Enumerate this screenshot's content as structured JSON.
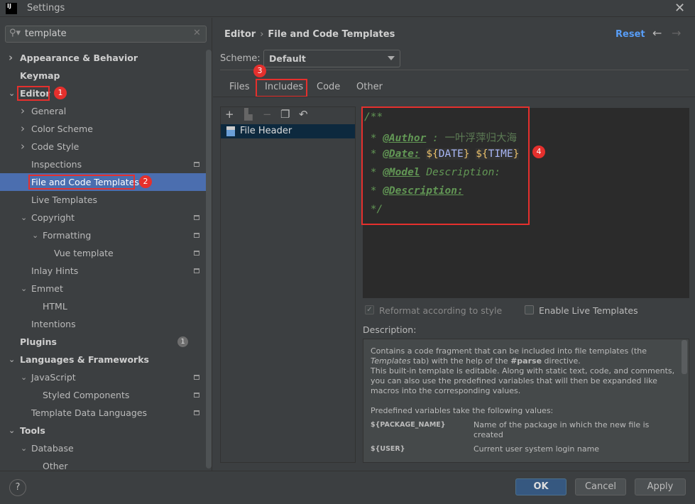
{
  "window": {
    "title": "Settings",
    "app_icon": "IJ"
  },
  "search": {
    "value": "template"
  },
  "tree": [
    {
      "label": "Appearance & Behavior",
      "level": 0,
      "chevron": "right",
      "bold": true
    },
    {
      "label": "Keymap",
      "level": 0,
      "bold": true
    },
    {
      "label": "Editor",
      "level": 0,
      "chevron": "down",
      "bold": true,
      "annotation": "1"
    },
    {
      "label": "General",
      "level": 1,
      "chevron": "right"
    },
    {
      "label": "Color Scheme",
      "level": 1,
      "chevron": "right"
    },
    {
      "label": "Code Style",
      "level": 1,
      "chevron": "right"
    },
    {
      "label": "Inspections",
      "level": 1,
      "project_icon": true
    },
    {
      "label": "File and Code Templates",
      "level": 1,
      "selected": true,
      "annotation": "2"
    },
    {
      "label": "Live Templates",
      "level": 1
    },
    {
      "label": "Copyright",
      "level": 1,
      "chevron": "down",
      "project_icon": true
    },
    {
      "label": "Formatting",
      "level": 2,
      "chevron": "down",
      "project_icon": true
    },
    {
      "label": "Vue template",
      "level": 3,
      "project_icon": true
    },
    {
      "label": "Inlay Hints",
      "level": 1,
      "project_icon": true
    },
    {
      "label": "Emmet",
      "level": 1,
      "chevron": "down"
    },
    {
      "label": "HTML",
      "level": 2
    },
    {
      "label": "Intentions",
      "level": 1
    },
    {
      "label": "Plugins",
      "level": 0,
      "bold": true,
      "count": "1"
    },
    {
      "label": "Languages & Frameworks",
      "level": 0,
      "chevron": "down",
      "bold": true
    },
    {
      "label": "JavaScript",
      "level": 1,
      "chevron": "down",
      "project_icon": true
    },
    {
      "label": "Styled Components",
      "level": 2,
      "project_icon": true
    },
    {
      "label": "Template Data Languages",
      "level": 1,
      "project_icon": true
    },
    {
      "label": "Tools",
      "level": 0,
      "chevron": "down",
      "bold": true
    },
    {
      "label": "Database",
      "level": 1,
      "chevron": "down"
    },
    {
      "label": "Other",
      "level": 2
    }
  ],
  "header": {
    "breadcrumb": [
      "Editor",
      "File and Code Templates"
    ],
    "reset": "Reset"
  },
  "scheme": {
    "label": "Scheme:",
    "value": "Default"
  },
  "tabs": [
    {
      "label": "Files"
    },
    {
      "label": "Includes",
      "selected": true,
      "annotation": "3"
    },
    {
      "label": "Code"
    },
    {
      "label": "Other"
    }
  ],
  "templates": [
    {
      "label": "File Header",
      "selected": true
    }
  ],
  "editor": {
    "annotation": "4",
    "lines": {
      "l1": "/**",
      "l2_star": " * ",
      "l2_tag": "@Author",
      "l2_rest": " : ",
      "l2_cn": "一叶浮萍归大海",
      "l3_star": " * ",
      "l3_tag": "@Date:",
      "l3_sp": " ",
      "l3_v1a": "${",
      "l3_v1b": "DATE",
      "l3_v1c": "}",
      "l3_v2a": "${",
      "l3_v2b": "TIME",
      "l3_v2c": "}",
      "l4_star": " * ",
      "l4_tag": "@Model",
      "l4_rest": " Description:",
      "l5_star": " * ",
      "l5_tag": "@Description:",
      "l6": " */"
    }
  },
  "options": {
    "reformat": {
      "label": "Reformat according to style",
      "checked": true,
      "disabled": true
    },
    "live_templates": {
      "label": "Enable Live Templates",
      "checked": false
    }
  },
  "description": {
    "label": "Description:",
    "p1a": "Contains a code fragment that can be included into file templates (the ",
    "p1b": "Templates",
    "p1c": " tab) with the help of the ",
    "p1d": "#parse",
    "p1e": " directive.",
    "p2": "This built-in template is editable. Along with static text, code, and comments, you can also use the predefined variables that will then be expanded like macros into the corresponding values.",
    "p3": "Predefined variables take the following values:",
    "vars": [
      {
        "name": "${PACKAGE_NAME}",
        "desc": "Name of the package in which the new file is created"
      },
      {
        "name": "${USER}",
        "desc": "Current user system login name"
      }
    ]
  },
  "buttons": {
    "ok": "OK",
    "cancel": "Cancel",
    "apply": "Apply",
    "help": "?"
  },
  "colors": {
    "accent": "#4b6eaf",
    "annotation": "#e5302d",
    "link": "#589df6"
  }
}
